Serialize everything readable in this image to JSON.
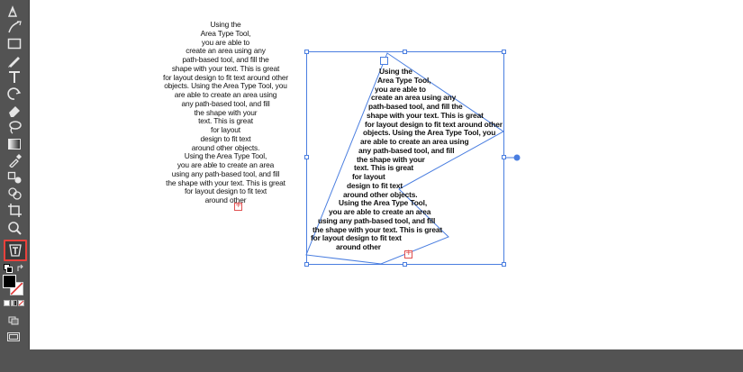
{
  "toolbar": {
    "tools": [
      {
        "name": "pen-tool",
        "icon": "pen-icon"
      },
      {
        "name": "curvature-tool",
        "icon": "curvature-icon"
      },
      {
        "name": "rectangle-tool",
        "icon": "rectangle-icon"
      },
      {
        "name": "pencil-tool",
        "icon": "pencil-icon"
      },
      {
        "name": "type-tool",
        "icon": "type-icon"
      },
      {
        "name": "rotate-tool",
        "icon": "rotate-icon"
      },
      {
        "name": "eraser-tool",
        "icon": "eraser-icon"
      },
      {
        "name": "lasso-tool",
        "icon": "lasso-icon"
      },
      {
        "name": "gradient-tool",
        "icon": "gradient-icon"
      },
      {
        "name": "eyedropper-tool",
        "icon": "eyedropper-icon"
      },
      {
        "name": "blend-tool",
        "icon": "blend-icon"
      },
      {
        "name": "shape-builder-tool",
        "icon": "shape-builder-icon"
      },
      {
        "name": "crop-tool",
        "icon": "crop-icon"
      },
      {
        "name": "zoom-tool",
        "icon": "zoom-icon"
      },
      {
        "name": "area-type-tool",
        "icon": "area-type-icon",
        "selected": true
      }
    ],
    "more_label": "•••",
    "selected_highlight_color": "#e8413c"
  },
  "canvas": {
    "selection_color": "#4a7ee0",
    "overflow_color": "#e05050",
    "left_text": [
      "Using the",
      "Area Type Tool,",
      "you are able to",
      "create an area using any",
      "path-based tool, and fill the",
      "shape with your text. This is great",
      "for layout design to fit text around other",
      "objects.  Using the Area Type Tool, you",
      "are able to create an area using",
      "any path-based tool, and fill",
      "the shape with your",
      "text. This is great",
      "for layout",
      "design to fit text",
      "around other objects.",
      "Using the Area Type Tool,",
      "you are able to create an area",
      "using any path-based tool, and fill",
      "the shape with your text. This is great",
      "for layout design to fit text",
      "around other"
    ],
    "shape_text": [
      "Using the",
      "Area Type Tool,",
      "you are able to",
      "create an area using any",
      "path-based tool, and fill the",
      "shape with your text. This is great",
      "for layout design to fit text around other",
      "objects.  Using the Area Type Tool, you",
      "are able to create an area using",
      "any path-based tool, and fill",
      "the shape with your",
      "text. This is great",
      "for layout",
      "design to fit text",
      "around other objects.",
      "Using the Area Type Tool,",
      "you are able to create an area",
      "using any path-based tool, and fill",
      "the shape with your text. This is great",
      "for layout design to fit text",
      "around other"
    ]
  }
}
